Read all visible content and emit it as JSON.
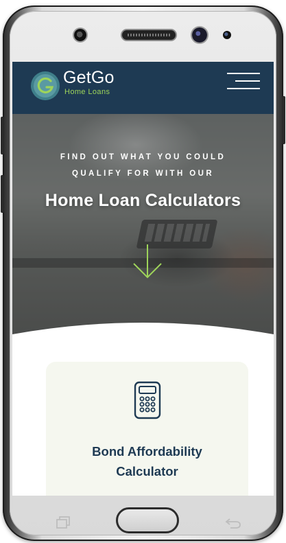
{
  "brand": {
    "name": "GetGo",
    "tagline": "Home Loans",
    "accent_color": "#9ed45a",
    "navbar_color": "#1e3a53"
  },
  "navbar": {
    "menu_icon": "hamburger-menu-icon"
  },
  "hero": {
    "line1": "FIND OUT WHAT YOU COULD",
    "line2": "QUALIFY FOR WITH OUR",
    "title": "Home Loan Calculators",
    "arrow_icon": "arrow-down-icon"
  },
  "card": {
    "icon": "calculator-icon",
    "title_line1": "Bond Affordability",
    "title_line2": "Calculator",
    "background": "#f5f7ef"
  },
  "device": {
    "nav_icons": [
      "recent-apps-icon",
      "home-button",
      "back-icon"
    ]
  }
}
